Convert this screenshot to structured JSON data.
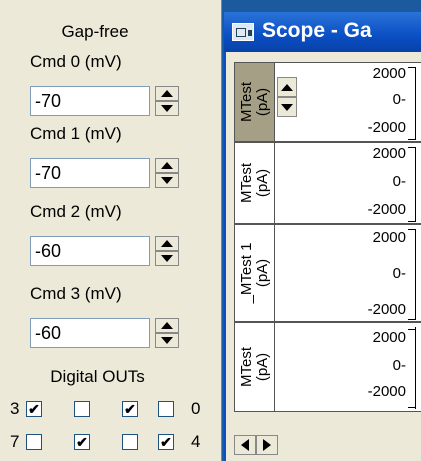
{
  "colors": {
    "desktop": "#1b5a9e",
    "panel": "#ece9d8",
    "titlebar": "#0a4fc4",
    "active_channel": "#a59f85"
  },
  "panel": {
    "title": "Gap-free",
    "commands": [
      {
        "label": "Cmd 0 (mV)",
        "value": "-70"
      },
      {
        "label": "Cmd 1 (mV)",
        "value": "-70"
      },
      {
        "label": "Cmd 2 (mV)",
        "value": "-60"
      },
      {
        "label": "Cmd 3 (mV)",
        "value": "-60"
      }
    ],
    "digital_label": "Digital OUTs",
    "digital_rows": [
      {
        "left": "3",
        "right": "0",
        "checks": [
          true,
          false,
          true,
          false
        ]
      },
      {
        "left": "7",
        "right": "4",
        "checks": [
          false,
          true,
          false,
          true
        ]
      }
    ]
  },
  "scope": {
    "title": "Scope - Ga",
    "icon": "scope-window-icon",
    "channels": [
      {
        "label": "MTest\n(pA)",
        "top": "2000",
        "mid": "0-",
        "bottom": "-2000",
        "active": true
      },
      {
        "label": "MTest\n(pA)",
        "top": "2000",
        "mid": "0-",
        "bottom": "-2000",
        "active": false
      },
      {
        "label": "_MTest 1\n(pA)",
        "top": "2000",
        "mid": "0-",
        "bottom": "-2000",
        "active": false
      },
      {
        "label": "MTest\n(pA)",
        "top": "2000",
        "mid": "0-",
        "bottom": "-2000",
        "active": false
      }
    ],
    "checkmark": "✔"
  }
}
